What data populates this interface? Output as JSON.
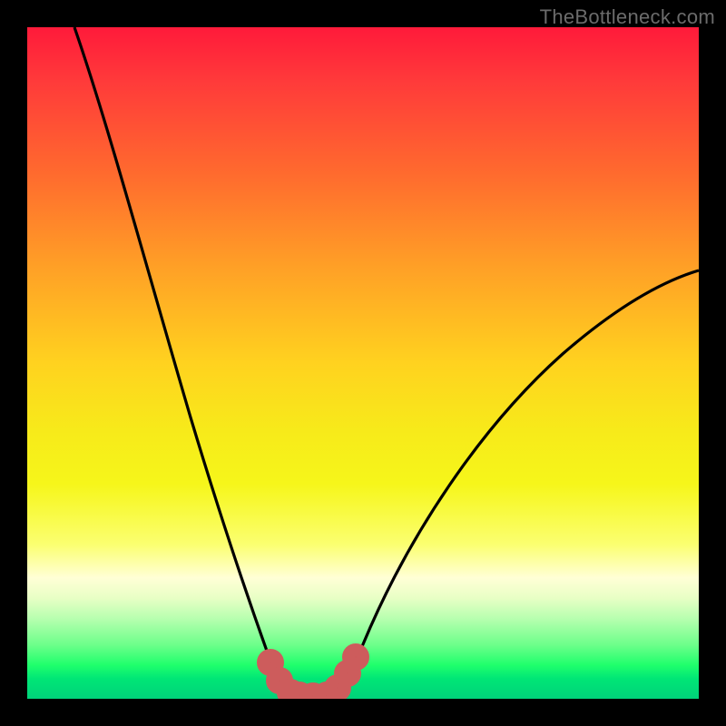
{
  "watermark": "TheBottleneck.com",
  "colors": {
    "frame": "#000000",
    "curve": "#000000",
    "datapoints": "#cd5c5c",
    "gradient_top": "#ff1a3a",
    "gradient_bottom": "#00d27a"
  },
  "chart_data": {
    "type": "line",
    "title": "",
    "xlabel": "",
    "ylabel": "",
    "xlim": [
      0,
      100
    ],
    "ylim": [
      0,
      100
    ],
    "curve": {
      "description": "V-shaped bottleneck curve",
      "points": [
        {
          "x": 7,
          "y": 100
        },
        {
          "x": 12,
          "y": 85
        },
        {
          "x": 18,
          "y": 65
        },
        {
          "x": 24,
          "y": 45
        },
        {
          "x": 30,
          "y": 25
        },
        {
          "x": 34,
          "y": 12
        },
        {
          "x": 37,
          "y": 4
        },
        {
          "x": 40,
          "y": 0
        },
        {
          "x": 45,
          "y": 0
        },
        {
          "x": 48,
          "y": 4
        },
        {
          "x": 55,
          "y": 15
        },
        {
          "x": 65,
          "y": 30
        },
        {
          "x": 78,
          "y": 45
        },
        {
          "x": 90,
          "y": 55
        },
        {
          "x": 100,
          "y": 62
        }
      ]
    },
    "highlighted_segment": {
      "description": "flat valley region highlighted in coral",
      "points": [
        {
          "x": 36,
          "y": 5
        },
        {
          "x": 38,
          "y": 1.5
        },
        {
          "x": 40,
          "y": 0.5
        },
        {
          "x": 43,
          "y": 0.5
        },
        {
          "x": 45,
          "y": 0.5
        },
        {
          "x": 47,
          "y": 2
        },
        {
          "x": 49,
          "y": 6
        }
      ]
    }
  }
}
